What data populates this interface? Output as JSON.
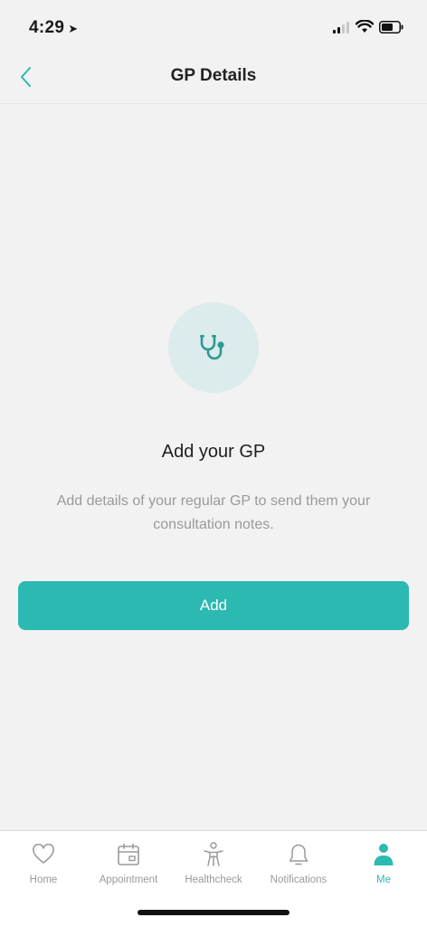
{
  "status_bar": {
    "time": "4:29",
    "location_glyph": "➤"
  },
  "nav": {
    "title": "GP Details",
    "back_icon": "chevron-left-icon"
  },
  "empty_state": {
    "icon": "stethoscope-icon",
    "title": "Add your GP",
    "description": "Add details of your regular GP to send them your consultation notes."
  },
  "actions": {
    "add_label": "Add"
  },
  "tabs": [
    {
      "label": "Home",
      "icon": "heart-icon",
      "active": false
    },
    {
      "label": "Appointment",
      "icon": "calendar-icon",
      "active": false
    },
    {
      "label": "Healthcheck",
      "icon": "body-icon",
      "active": false
    },
    {
      "label": "Notifications",
      "icon": "bell-icon",
      "active": false
    },
    {
      "label": "Me",
      "icon": "person-icon",
      "active": true
    }
  ],
  "colors": {
    "accent": "#2bb9b2",
    "background": "#f2f2f2",
    "hero_circle": "#dcebeb",
    "muted_text": "#9a9a9a"
  }
}
